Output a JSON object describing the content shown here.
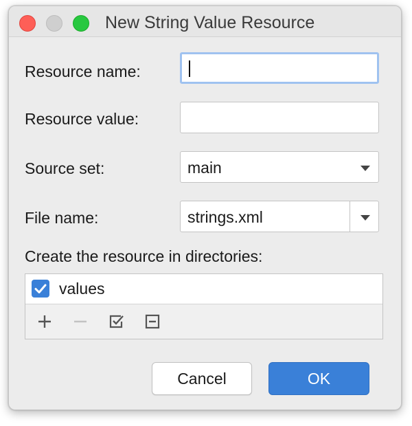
{
  "window": {
    "title": "New String Value Resource"
  },
  "form": {
    "resource_name": {
      "label": "Resource name:",
      "value": ""
    },
    "resource_value": {
      "label": "Resource value:",
      "value": ""
    },
    "source_set": {
      "label": "Source set:",
      "value": "main"
    },
    "file_name": {
      "label": "File name:",
      "value": "strings.xml"
    }
  },
  "directories": {
    "label": "Create the resource in directories:",
    "items": [
      {
        "label": "values",
        "checked": true
      }
    ]
  },
  "buttons": {
    "cancel": "Cancel",
    "ok": "OK"
  },
  "colors": {
    "accent": "#3a80d8",
    "focus_ring": "#9fc2f0"
  }
}
